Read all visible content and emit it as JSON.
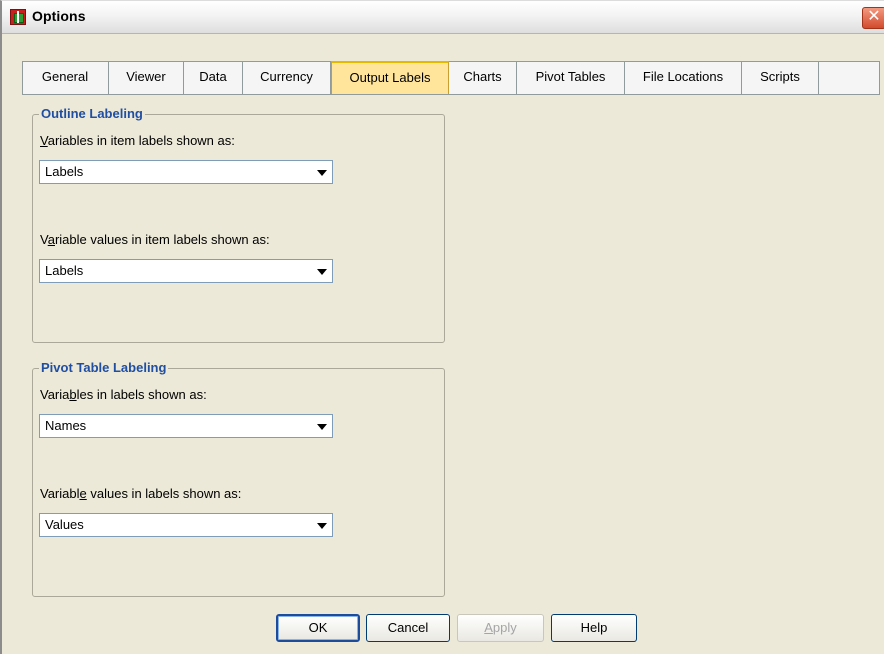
{
  "window": {
    "title": "Options",
    "close_glyph": "✕"
  },
  "tabs": [
    {
      "label": "General"
    },
    {
      "label": "Viewer"
    },
    {
      "label": "Data"
    },
    {
      "label": "Currency"
    },
    {
      "label": "Output Labels",
      "active": true
    },
    {
      "label": "Charts"
    },
    {
      "label": "Pivot Tables"
    },
    {
      "label": "File Locations"
    },
    {
      "label": "Scripts"
    }
  ],
  "outline": {
    "title": "Outline Labeling",
    "var_label_pre": "",
    "var_label_key": "V",
    "var_label_post": "ariables in item labels shown as:",
    "var_value": "Labels",
    "val_label_pre": "V",
    "val_label_key": "a",
    "val_label_post": "riable values in item labels shown as:",
    "val_value": "Labels"
  },
  "pivot": {
    "title": "Pivot Table Labeling",
    "var_label_pre": "Varia",
    "var_label_key": "b",
    "var_label_post": "les in labels shown as:",
    "var_value": "Names",
    "val_label_pre": "Variabl",
    "val_label_key": "e",
    "val_label_post": " values in labels shown as:",
    "val_value": "Values"
  },
  "buttons": {
    "ok": "OK",
    "cancel": "Cancel",
    "apply_key": "A",
    "apply_rest": "pply",
    "help": "Help"
  },
  "colors": {
    "active_tab": "#ffe59c",
    "group_title": "#1f4ea3",
    "dialog_bg": "#ece9d8"
  },
  "icons": {
    "app": "spss-app-icon",
    "close": "close-icon",
    "dropdown": "dropdown-arrow-icon"
  }
}
